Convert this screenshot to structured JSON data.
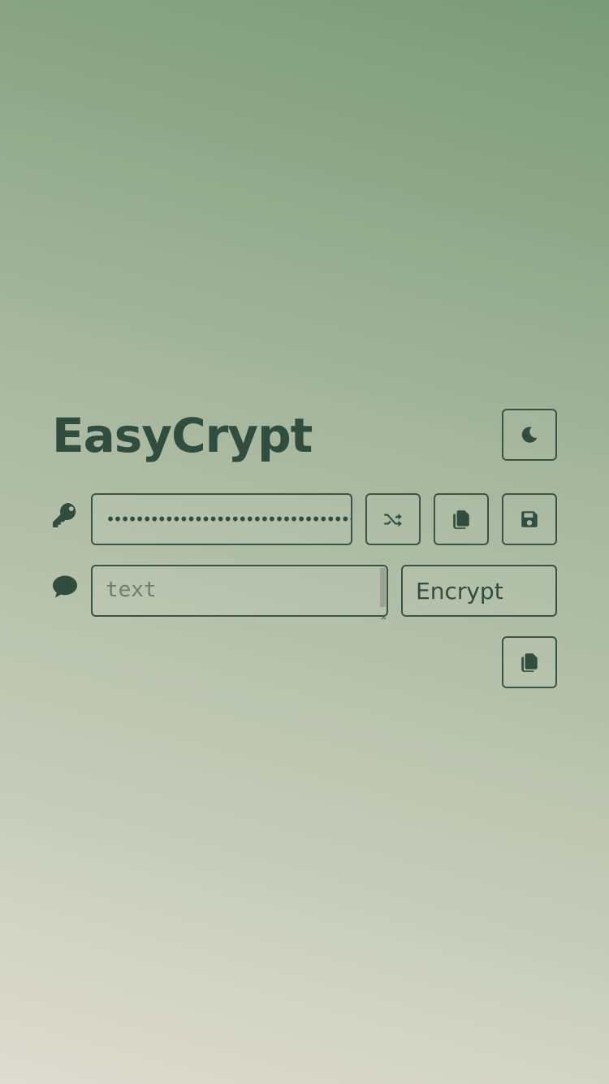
{
  "app": {
    "title": "EasyCrypt"
  },
  "key": {
    "value": "••••••••••••••••••••••••••••••••••"
  },
  "message": {
    "placeholder": "text",
    "value": ""
  },
  "mode": {
    "selected": "Encrypt"
  },
  "icons": {
    "theme": "moon-icon",
    "key": "key-icon",
    "shuffle": "shuffle-icon",
    "copy": "copy-icon",
    "save": "save-icon",
    "message": "speech-bubble-icon"
  },
  "colors": {
    "accent": "#304d40",
    "border": "#3a5548"
  }
}
